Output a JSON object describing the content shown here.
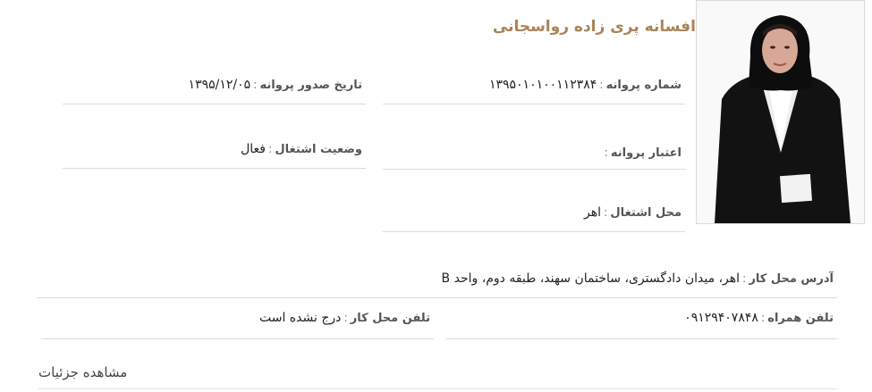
{
  "profile": {
    "name": "افسانه پری زاده رواسجانی"
  },
  "fields": {
    "license_number": {
      "label": "شماره پروانه",
      "value": "۱۳۹۵۰۱۰۱۰۰۱۱۲۳۸۴"
    },
    "license_issue_date": {
      "label": "تاریخ صدور پروانه",
      "value": "۱۳۹۵/۱۲/۰۵"
    },
    "license_validity": {
      "label": "اعتبار پروانه",
      "value": ""
    },
    "employment_status": {
      "label": "وضعیت اشتغال",
      "value": "فعال"
    },
    "work_city": {
      "label": "محل اشتغال",
      "value": "اهر"
    },
    "work_address": {
      "label": "آدرس محل کار",
      "value": "اهر، میدان دادگستری، ساختمان سهند، طبقه دوم، واحد B"
    },
    "mobile_phone": {
      "label": "تلفن همراه",
      "value": "۰۹۱۲۹۴۰۷۸۴۸"
    },
    "work_phone": {
      "label": "تلفن محل کار",
      "value": "درج نشده است"
    }
  },
  "actions": {
    "view_details": "مشاهده جزئیات"
  },
  "colors": {
    "name_accent": "#a9845a",
    "divider": "#dcdcdc"
  }
}
